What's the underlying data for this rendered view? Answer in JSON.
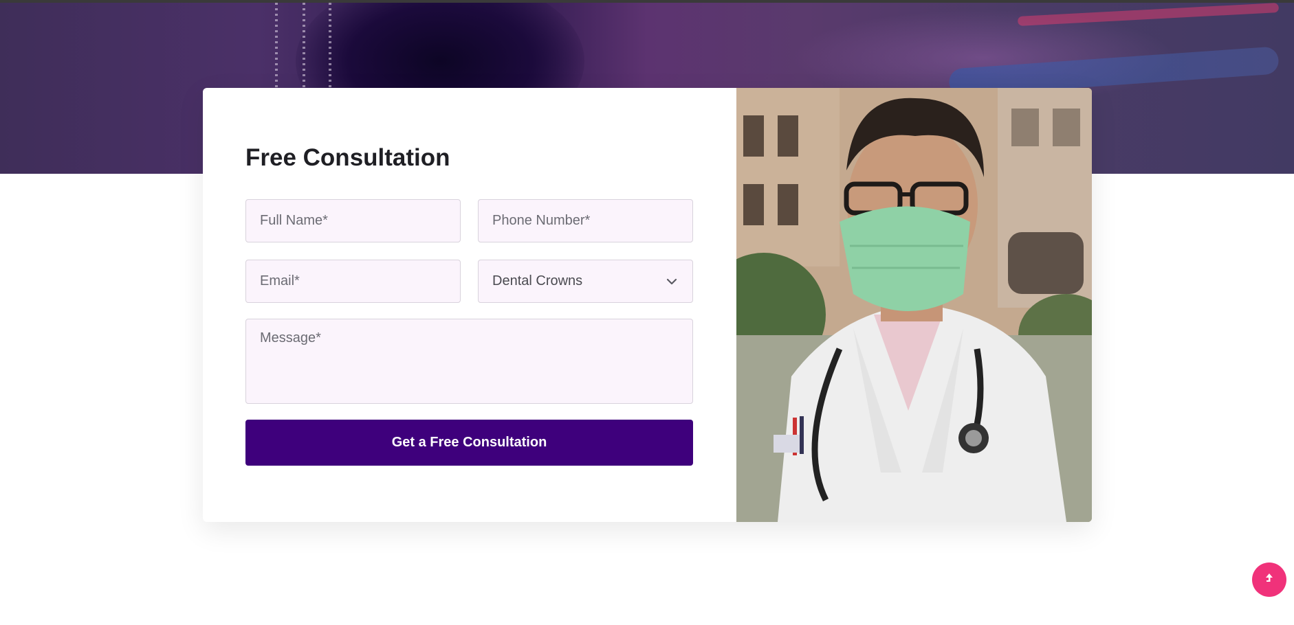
{
  "form": {
    "title": "Free Consultation",
    "full_name_placeholder": "Full Name*",
    "phone_placeholder": "Phone Number*",
    "email_placeholder": "Email*",
    "service_selected": "Dental Crowns",
    "message_placeholder": "Message*",
    "submit_label": "Get a Free Consultation"
  },
  "icons": {
    "select_chevron": "chevron-down-icon",
    "scroll_top": "arrow-up-icon"
  },
  "colors": {
    "primary_button": "#3e007c",
    "scroll_top_button": "#f0327a",
    "field_background": "#fbf4fc",
    "hero_overlay": "#4b3068"
  }
}
